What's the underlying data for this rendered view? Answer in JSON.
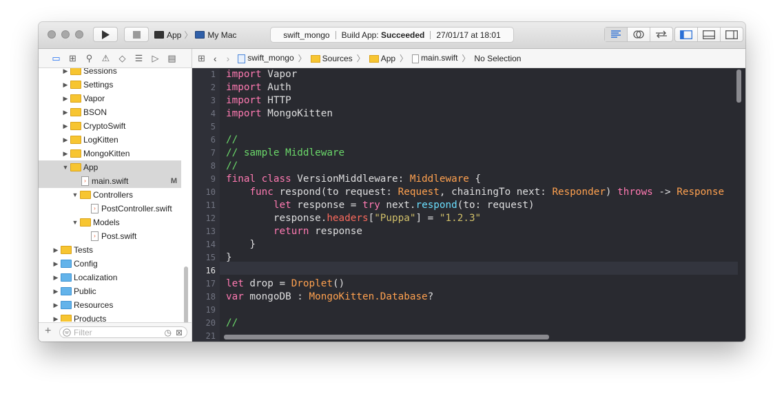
{
  "toolbar": {
    "scheme_app": "App",
    "scheme_destination": "My Mac",
    "status_project": "swift_mongo",
    "status_build_prefix": "Build App:",
    "status_build_result": "Succeeded",
    "status_timestamp": "27/01/17 at 18:01"
  },
  "navigator": {
    "rows": [
      {
        "label": "Sessions",
        "kind": "folder-yellow",
        "indent": 1,
        "expanded": false
      },
      {
        "label": "Settings",
        "kind": "folder-yellow",
        "indent": 1,
        "expanded": false
      },
      {
        "label": "Vapor",
        "kind": "folder-yellow",
        "indent": 1,
        "expanded": false
      },
      {
        "label": "BSON",
        "kind": "folder-yellow",
        "indent": 1,
        "expanded": false
      },
      {
        "label": "CryptoSwift",
        "kind": "folder-yellow",
        "indent": 1,
        "expanded": false
      },
      {
        "label": "LogKitten",
        "kind": "folder-yellow",
        "indent": 1,
        "expanded": false
      },
      {
        "label": "MongoKitten",
        "kind": "folder-yellow",
        "indent": 1,
        "expanded": false
      },
      {
        "label": "App",
        "kind": "folder-yellow",
        "indent": 1,
        "expanded": true,
        "selected": true
      },
      {
        "label": "main.swift",
        "kind": "file",
        "indent": 2,
        "badge": "M",
        "selected": true
      },
      {
        "label": "Controllers",
        "kind": "folder-yellow",
        "indent": 2,
        "expanded": true
      },
      {
        "label": "PostController.swift",
        "kind": "file",
        "indent": 3
      },
      {
        "label": "Models",
        "kind": "folder-yellow",
        "indent": 2,
        "expanded": true
      },
      {
        "label": "Post.swift",
        "kind": "file",
        "indent": 3
      },
      {
        "label": "Tests",
        "kind": "folder-yellow",
        "indent": 0,
        "expanded": false
      },
      {
        "label": "Config",
        "kind": "folder-blue",
        "indent": 0,
        "expanded": false
      },
      {
        "label": "Localization",
        "kind": "folder-blue",
        "indent": 0,
        "expanded": false
      },
      {
        "label": "Public",
        "kind": "folder-blue",
        "indent": 0,
        "expanded": false
      },
      {
        "label": "Resources",
        "kind": "folder-blue",
        "indent": 0,
        "expanded": false
      },
      {
        "label": "Products",
        "kind": "folder-yellow",
        "indent": 0,
        "expanded": false
      }
    ],
    "filter_placeholder": "Filter"
  },
  "jumpbar": {
    "crumbs": [
      "swift_mongo",
      "Sources",
      "App",
      "main.swift",
      "No Selection"
    ]
  },
  "editor": {
    "current_line": 16,
    "lines": [
      {
        "n": "1",
        "html": "<span class=\"kw\">import</span> Vapor"
      },
      {
        "n": "2",
        "html": "<span class=\"kw\">import</span> Auth"
      },
      {
        "n": "3",
        "html": "<span class=\"kw\">import</span> HTTP"
      },
      {
        "n": "4",
        "html": "<span class=\"kw\">import</span> MongoKitten"
      },
      {
        "n": "5",
        "html": ""
      },
      {
        "n": "6",
        "html": "<span class=\"cm\">//</span>"
      },
      {
        "n": "7",
        "html": "<span class=\"cm\">// sample Middleware</span>"
      },
      {
        "n": "8",
        "html": "<span class=\"cm\">//</span>"
      },
      {
        "n": "9",
        "html": "<span class=\"kw\">final class</span> VersionMiddleware: <span class=\"rt\">Middleware</span> {"
      },
      {
        "n": "10",
        "html": "    <span class=\"kw\">func</span> respond(to request: <span class=\"rt\">Request</span>, chainingTo next: <span class=\"rt\">Responder</span>) <span class=\"kw\">throws</span> -> <span class=\"rt\">Response</span>"
      },
      {
        "n": "11",
        "html": "        <span class=\"kw\">let</span> response = <span class=\"kw\">try</span> next.<span class=\"fn\">respond</span>(to: request)"
      },
      {
        "n": "12",
        "html": "        response.<span class=\"st\">headers</span>[<span class=\"str\">\"Puppa\"</span>] = <span class=\"str\">\"1.2.3\"</span>"
      },
      {
        "n": "13",
        "html": "        <span class=\"kw\">return</span> response"
      },
      {
        "n": "14",
        "html": "    }"
      },
      {
        "n": "15",
        "html": "}"
      },
      {
        "n": "16",
        "html": ""
      },
      {
        "n": "17",
        "html": "<span class=\"kw\">let</span> drop = <span class=\"rt\">Droplet</span>()"
      },
      {
        "n": "18",
        "html": "<span class=\"kw\">var</span> mongoDB : <span class=\"rt\">MongoKitten.Database</span>?"
      },
      {
        "n": "19",
        "html": ""
      },
      {
        "n": "20",
        "html": "<span class=\"cm\">//</span>"
      },
      {
        "n": "21",
        "html": ""
      }
    ]
  },
  "colors": {
    "editor_bg": "#292a30",
    "keyword": "#ff7ab2",
    "comment": "#6bd86a",
    "type": "#ffa14f",
    "string": "#d0bf69",
    "accent": "#1c6ef2"
  },
  "icons": [
    "play-icon",
    "stop-icon",
    "project-navigator-icon",
    "filter-icon"
  ]
}
